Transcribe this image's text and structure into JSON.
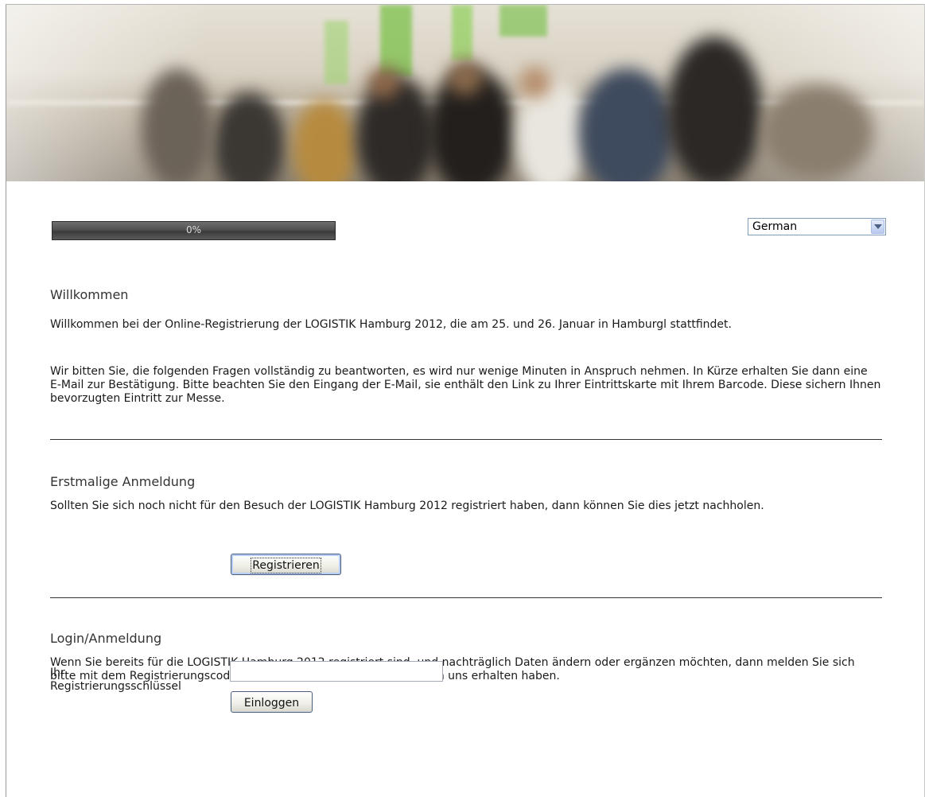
{
  "banner": {
    "alt_icon": "crowd-photo"
  },
  "progress": {
    "label": "0%",
    "value": 0
  },
  "language": {
    "selected": "German"
  },
  "welcome": {
    "heading": "Willkommen",
    "para1": "Willkommen bei der Online-Registrierung der LOGISTIK Hamburg 2012, die am 25. und 26. Januar in Hamburgl stattfindet.",
    "para2": "Wir bitten Sie, die folgenden Fragen vollständig zu beantworten, es wird nur wenige Minuten in Anspruch nehmen. In Kürze erhalten Sie dann eine E-Mail zur Bestätigung. Bitte beachten Sie den Eingang der E-Mail, sie enthält den Link zu Ihrer Eintrittskarte mit Ihrem Barcode. Diese sichern Ihnen bevorzugten Eintritt zur Messe."
  },
  "first_registration": {
    "heading": "Erstmalige Anmeldung",
    "text": "Sollten Sie sich noch nicht für den Besuch der LOGISTIK Hamburg 2012 registriert haben, dann können Sie dies jetzt nachholen.",
    "button": "Registrieren"
  },
  "login": {
    "heading": "Login/Anmeldung",
    "text": "Wenn Sie bereits für die LOGISTIK Hamburg 2012 registriert sind, und nachträglich Daten ändern oder ergänzen möchten, dann melden Sie sich bitte mit dem Registrierungscode an, den Sie bei Ihrer Anmeldung von uns erhalten haben.",
    "field_label_line1": "Ihr",
    "field_label_line2": "Registrierungsschlüssel",
    "field_value": "",
    "button": "Einloggen"
  }
}
